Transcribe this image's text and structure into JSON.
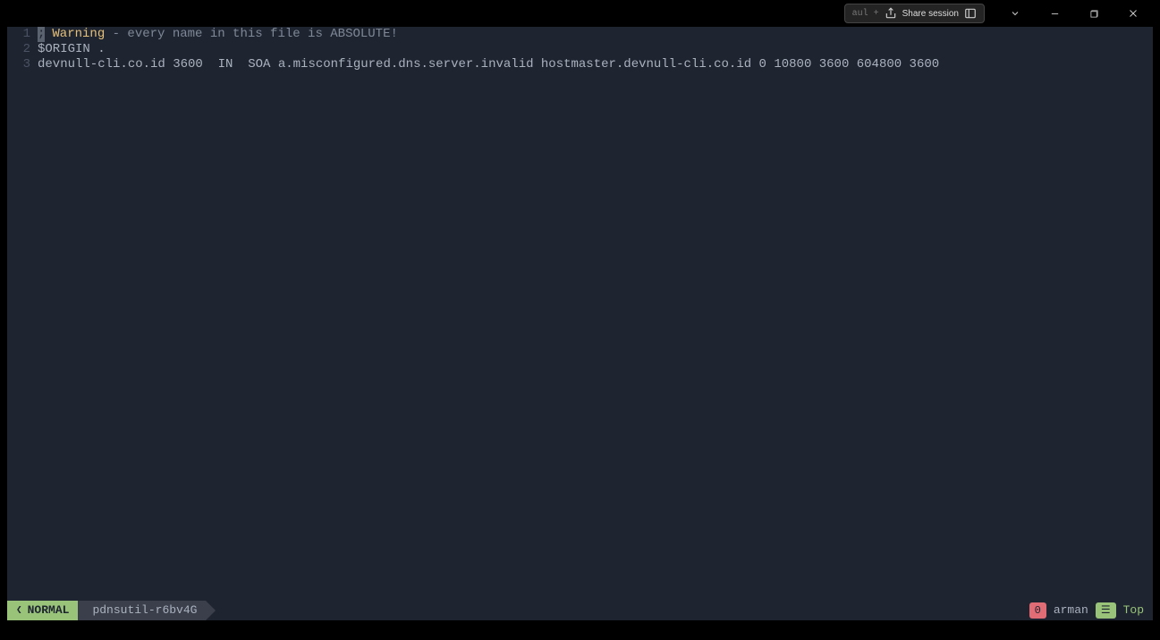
{
  "titlebar": {
    "dim_hint": "aul +",
    "share_label": "Share session"
  },
  "editor": {
    "lines": [
      {
        "num": "1",
        "prefix_semi": "; ",
        "warning": "Warning",
        "rest": " - every name in this file is ABSOLUTE!"
      },
      {
        "num": "2",
        "text": "$ORIGIN ."
      },
      {
        "num": "3",
        "text": "devnull-cli.co.id 3600  IN  SOA a.misconfigured.dns.server.invalid hostmaster.devnull-cli.co.id 0 10800 3600 604800 3600"
      }
    ]
  },
  "statusline": {
    "mode": "NORMAL",
    "filename": "pdnsutil-r6bv4G",
    "err_count": "0",
    "user": "arman",
    "pos_icon": "☰",
    "pos_text": "Top"
  }
}
